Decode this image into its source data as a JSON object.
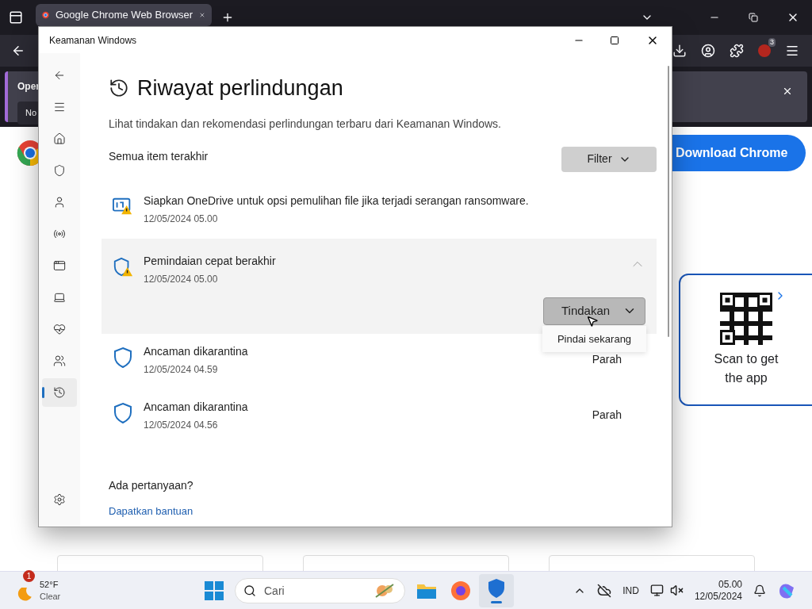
{
  "browser": {
    "tab_title": "Google Chrome Web Browser",
    "extension_badge": "3",
    "notification": {
      "text": "Oper",
      "button": "No"
    },
    "page": {
      "download_button": "Download Chrome",
      "qr_card": {
        "text": "Scan to get the app"
      }
    }
  },
  "security_window": {
    "title": "Keamanan Windows",
    "heading": "Riwayat perlindungan",
    "description": "Lihat tindakan dan rekomendasi perlindungan terbaru dari Keamanan Windows.",
    "filter_label": "Semua item terakhir",
    "filter_button": "Filter",
    "nav": [
      {
        "kind": "back",
        "selected": false
      },
      {
        "kind": "menu",
        "selected": false
      },
      {
        "kind": "home",
        "selected": false
      },
      {
        "kind": "shield",
        "selected": false
      },
      {
        "kind": "account",
        "selected": false
      },
      {
        "kind": "network",
        "selected": false
      },
      {
        "kind": "app",
        "selected": false
      },
      {
        "kind": "device",
        "selected": false
      },
      {
        "kind": "health",
        "selected": false
      },
      {
        "kind": "family",
        "selected": false
      },
      {
        "kind": "history",
        "selected": true
      },
      {
        "kind": "settings",
        "selected": false
      }
    ],
    "items": [
      {
        "kind": "onedrive",
        "title": "Siapkan OneDrive untuk opsi pemulihan file jika terjadi serangan ransomware.",
        "time": "12/05/2024 05.00",
        "expanded": false
      },
      {
        "kind": "shield-warning",
        "title": "Pemindaian cepat berakhir",
        "time": "12/05/2024 05.00",
        "expanded": true,
        "action_button": "Tindakan"
      },
      {
        "kind": "shield",
        "title": "Ancaman dikarantina",
        "time": "12/05/2024 04.59",
        "expanded": false,
        "severity": "Parah"
      },
      {
        "kind": "shield",
        "title": "Ancaman dikarantina",
        "time": "12/05/2024 04.56",
        "expanded": false,
        "severity": "Parah"
      }
    ],
    "menu_item": "Pindai sekarang",
    "help": {
      "question": "Ada pertanyaan?",
      "link": "Dapatkan bantuan"
    }
  },
  "taskbar": {
    "weather": {
      "badge": "1",
      "temperature": "52°F",
      "condition": "Clear"
    },
    "search_placeholder": "Cari",
    "language": "IND",
    "time": "05.00",
    "date": "12/05/2024"
  }
}
